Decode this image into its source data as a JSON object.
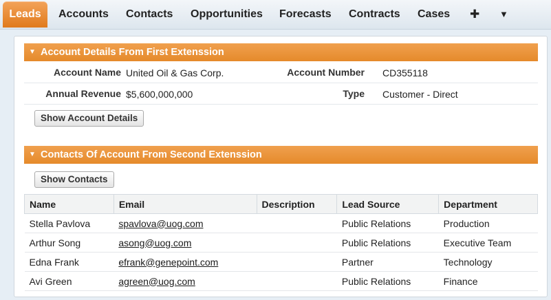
{
  "tabs": {
    "leads": "Leads",
    "accounts": "Accounts",
    "contacts": "Contacts",
    "opportunities": "Opportunities",
    "forecasts": "Forecasts",
    "contracts": "Contracts",
    "cases": "Cases",
    "add_icon": "plus-icon",
    "more_icon": "caret-down-icon",
    "active": "Leads"
  },
  "account_section": {
    "title": "Account Details From First Extenssion",
    "fields": {
      "account_name_label": "Account Name",
      "account_name_value": "United Oil & Gas Corp.",
      "account_number_label": "Account Number",
      "account_number_value": "CD355118",
      "annual_revenue_label": "Annual Revenue",
      "annual_revenue_value": "$5,600,000,000",
      "type_label": "Type",
      "type_value": "Customer - Direct"
    },
    "button_label": "Show Account Details"
  },
  "contacts_section": {
    "title": "Contacts Of Account From Second Extenssion",
    "button_label": "Show Contacts",
    "columns": [
      "Name",
      "Email",
      "Description",
      "Lead Source",
      "Department"
    ],
    "rows": [
      {
        "name": "Stella Pavlova",
        "email": "spavlova@uog.com",
        "description": "",
        "lead_source": "Public Relations",
        "department": "Production"
      },
      {
        "name": "Arthur Song",
        "email": "asong@uog.com",
        "description": "",
        "lead_source": "Public Relations",
        "department": "Executive Team"
      },
      {
        "name": "Edna Frank",
        "email": "efrank@genepoint.com",
        "description": "",
        "lead_source": "Partner",
        "department": "Technology"
      },
      {
        "name": "Avi Green",
        "email": "agreen@uog.com",
        "description": "",
        "lead_source": "Public Relations",
        "department": "Finance"
      }
    ]
  },
  "colors": {
    "accent_orange": "#e58a2b",
    "page_bg": "#e6eef5"
  }
}
